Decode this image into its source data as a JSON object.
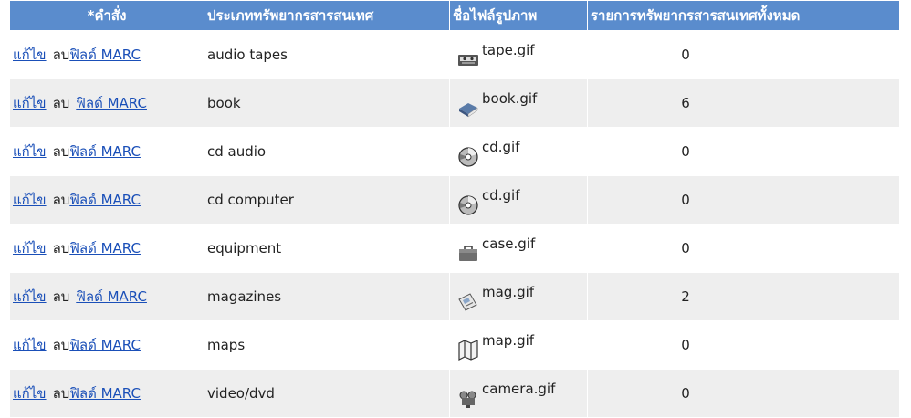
{
  "header": {
    "col_command": "*คำสั่ง",
    "col_type": "ประเภททรัพยากรสารสนเทศ",
    "col_image": "ชื่อไฟล์รูปภาพ",
    "col_count": "รายการทรัพยากรสารสนเทศทั้งหมด"
  },
  "actions": {
    "edit": "แก้ไข",
    "delete": "ลบ",
    "marc": "ฟิลด์ MARC"
  },
  "rows": [
    {
      "type": "audio tapes",
      "image": "tape.gif",
      "icon": "tape-icon",
      "count": "0",
      "delete_link": true
    },
    {
      "type": "book",
      "image": "book.gif",
      "icon": "book-icon",
      "count": "6",
      "delete_link": false
    },
    {
      "type": "cd audio",
      "image": "cd.gif",
      "icon": "cd-icon",
      "count": "0",
      "delete_link": true
    },
    {
      "type": "cd computer",
      "image": "cd.gif",
      "icon": "cd-icon",
      "count": "0",
      "delete_link": true
    },
    {
      "type": "equipment",
      "image": "case.gif",
      "icon": "case-icon",
      "count": "0",
      "delete_link": true
    },
    {
      "type": "magazines",
      "image": "mag.gif",
      "icon": "magazine-icon",
      "count": "2",
      "delete_link": false
    },
    {
      "type": "maps",
      "image": "map.gif",
      "icon": "map-icon",
      "count": "0",
      "delete_link": true
    },
    {
      "type": "video/dvd",
      "image": "camera.gif",
      "icon": "camera-icon",
      "count": "0",
      "delete_link": true
    }
  ],
  "colors": {
    "header_bg": "#5a8ccd",
    "link": "#1a4fb8",
    "stripe": "#eeeeee"
  }
}
